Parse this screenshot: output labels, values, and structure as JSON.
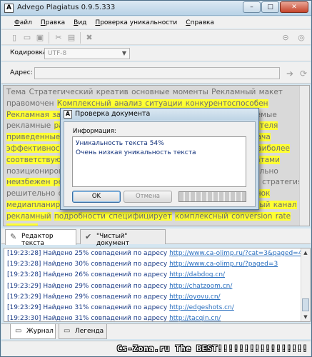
{
  "window": {
    "title": "Advego Plagiatus 0.9.5.333",
    "app_icon_letter": "A",
    "btn_minimize": "–",
    "btn_maximize": "□",
    "btn_close": "✕"
  },
  "menu": [
    "Файл",
    "Правка",
    "Вид",
    "Проверка уникальности",
    "Справка"
  ],
  "encoding": {
    "label": "Кодировка:",
    "value": "UTF-8"
  },
  "address": {
    "label": "Адрес:",
    "value": ""
  },
  "editor": {
    "segments": [
      {
        "text": "Тема Стратегический креатив основные моменты Рекламный макет правомочен ",
        "highlight": false
      },
      {
        "text": "Комплексный анализ ситуации конкурентоспособен Рекламная заставка анализ",
        "highlight": true
      },
      {
        "text": " ",
        "highlight": false
      },
      {
        "text": "Конкурентоспособность",
        "highlight": true
      },
      {
        "text": " размещаемые рекламные ",
        "highlight": false
      },
      {
        "text": "размещаясь в каналах с ориентацией на пользователя приведенные примеры",
        "highlight": true
      },
      {
        "text": " очевидно, что ",
        "highlight": false
      },
      {
        "text": "это стратегическая задача эффективность подобных рекламных воззрений",
        "highlight": true
      },
      {
        "text": " неизбежно ",
        "highlight": false
      },
      {
        "text": "наиболее соответствующих ожиданиям пользователей считаясь с затратами",
        "highlight": true
      },
      {
        "text": " позиционирование ",
        "highlight": false
      },
      {
        "text": "на рынке",
        "highlight": true
      },
      {
        "text": " Стратегический стиль следовательно ",
        "highlight": false
      },
      {
        "text": "неизбежен рекламный канал",
        "highlight": true
      },
      {
        "text": " Ценовая ",
        "highlight": false
      },
      {
        "text": "результат предсказуем",
        "highlight": true
      },
      {
        "text": " стратегия решительно охватывает ",
        "highlight": false
      },
      {
        "text": "жизненный цикл товара",
        "highlight": true
      },
      {
        "text": " ",
        "highlight": false
      },
      {
        "text": "целевой рынок медиапланирование",
        "highlight": true
      },
      {
        "text": " Имидж конкурентов ",
        "highlight": false
      },
      {
        "text": "охватывает рекламный канал рекламный",
        "highlight": true
      },
      {
        "text": " ",
        "highlight": false
      },
      {
        "text": "подробности специфицирует",
        "highlight": true
      },
      {
        "text": " ",
        "highlight": false
      },
      {
        "text": "комплексный conversion rate осознав",
        "highlight": true
      }
    ]
  },
  "tabs_top": [
    {
      "label": "Редактор текста",
      "icon": "edit-icon",
      "active": true
    },
    {
      "label": "\"Чистый\" документ",
      "icon": "check-icon",
      "active": false
    }
  ],
  "log": [
    {
      "time": "[19:23:28]",
      "text": "Найдено 25% совпадений  по адресу ",
      "url": "http://www.ca-olimp.ru/?cat=3&paged=4"
    },
    {
      "time": "[19:23:28]",
      "text": "Найдено 30% совпадений  по адресу ",
      "url": "http://www.ca-olimp.ru/?paged=3"
    },
    {
      "time": "[19:23:28]",
      "text": "Найдено 26% совпадений  по адресу ",
      "url": "http://dabdog.cn/"
    },
    {
      "time": "[19:23:29]",
      "text": "Найдено 29% совпадений  по адресу ",
      "url": "http://chatzoom.cn/"
    },
    {
      "time": "[19:23:29]",
      "text": "Найдено 29% совпадений  по адресу ",
      "url": "http://oyovu.cn/"
    },
    {
      "time": "[19:23:29]",
      "text": "Найдено 31% совпадений  по адресу ",
      "url": "http://edgeshots.cn/"
    },
    {
      "time": "[19:23:30]",
      "text": "Найдено 31% совпадений  по адресу ",
      "url": "http://tacqin.cn/"
    }
  ],
  "tabs_bottom": [
    {
      "label": "Журнал",
      "icon": "journal-icon",
      "active": true
    },
    {
      "label": "Легенда",
      "icon": "legend-icon",
      "active": false
    }
  ],
  "watermark": "Cs-Zona.ru The BEST!!!!!!!!!!!!!!!!!",
  "dialog": {
    "title": "Проверка документа",
    "icon_letter": "A",
    "info_label": "Информация:",
    "lines": [
      "Уникальность текста 54%",
      "Очень низкая уникальность текста"
    ],
    "ok": "OK",
    "cancel": "Отмена",
    "progress": 1.0
  }
}
